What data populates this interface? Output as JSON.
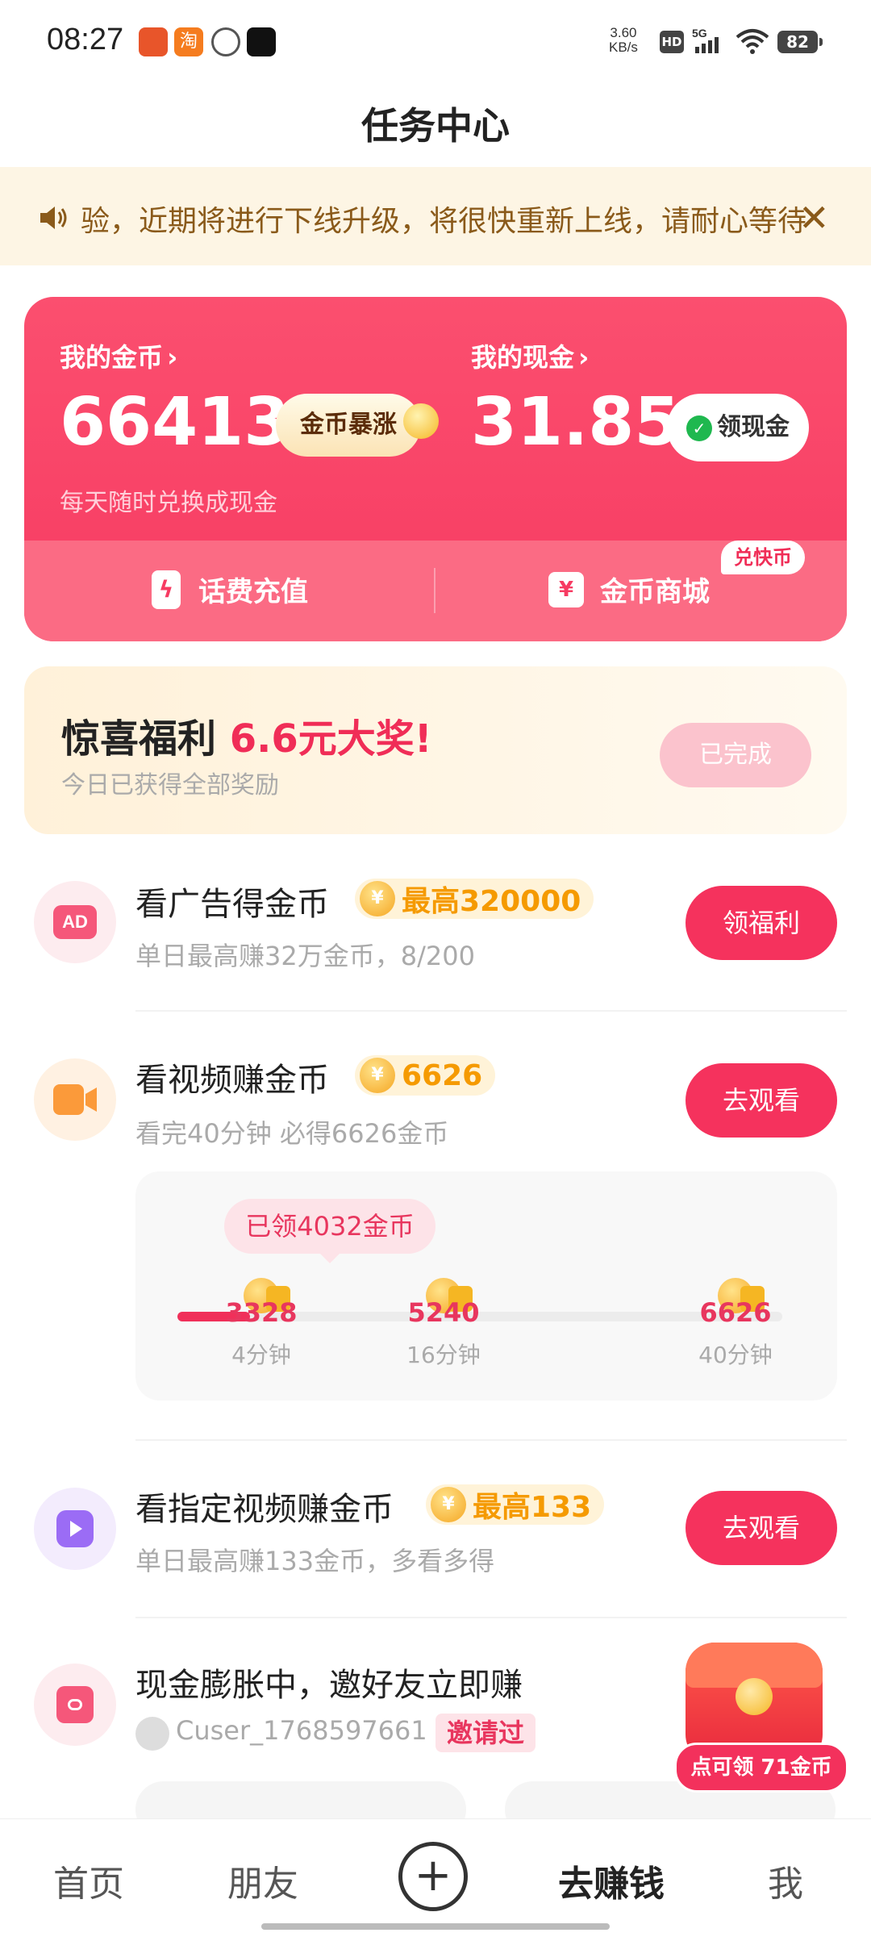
{
  "status": {
    "time": "08:27",
    "net_speed_value": "3.60",
    "net_speed_unit": "KB/s",
    "hd": "HD",
    "signal": "5G",
    "battery": "82"
  },
  "header": {
    "title": "任务中心"
  },
  "notice": {
    "text": "验，近期将进行下线升级，将很快重新上线，请耐心等待"
  },
  "wallet": {
    "coins_label": "我的金币",
    "coins_value": "66413",
    "coins_pill": "金币暴涨",
    "cash_label": "我的现金",
    "cash_value": "31.85",
    "cash_pill": "领现金",
    "subtitle": "每天随时兑换成现金",
    "recharge_label": "话费充值",
    "mall_label": "金币商城",
    "mall_badge": "兑快币"
  },
  "surprise": {
    "title_prefix": "惊喜福利",
    "title_highlight": "6.6元大奖!",
    "subtitle": "今日已获得全部奖励",
    "button": "已完成"
  },
  "tasks": [
    {
      "title": "看广告得金币",
      "reward": "最高320000",
      "subtitle": "单日最高赚32万金币，8/200",
      "button": "领福利",
      "icon": "ad-icon"
    },
    {
      "title": "看视频赚金币",
      "reward": "6626",
      "subtitle": "看完40分钟 必得6626金币",
      "button": "去观看",
      "icon": "video-camera-icon"
    },
    {
      "title": "看指定视频赚金币",
      "reward": "最高133",
      "subtitle": "单日最高赚133金币，多看多得",
      "button": "去观看",
      "icon": "play-icon"
    }
  ],
  "video_progress": {
    "tip": "已领4032金币",
    "progress_fraction": 0.12,
    "milestones": [
      {
        "value": "3328",
        "label": "4分钟"
      },
      {
        "value": "5240",
        "label": "16分钟"
      },
      {
        "value": "6626",
        "label": "40分钟"
      }
    ]
  },
  "invite": {
    "title": "现金膨胀中，邀好友立即赚",
    "user": "Cuser_1768597661",
    "tag": "邀请过",
    "float_label": "点可领 71金币"
  },
  "tabbar": {
    "home": "首页",
    "friends": "朋友",
    "earn": "去赚钱",
    "me": "我"
  }
}
